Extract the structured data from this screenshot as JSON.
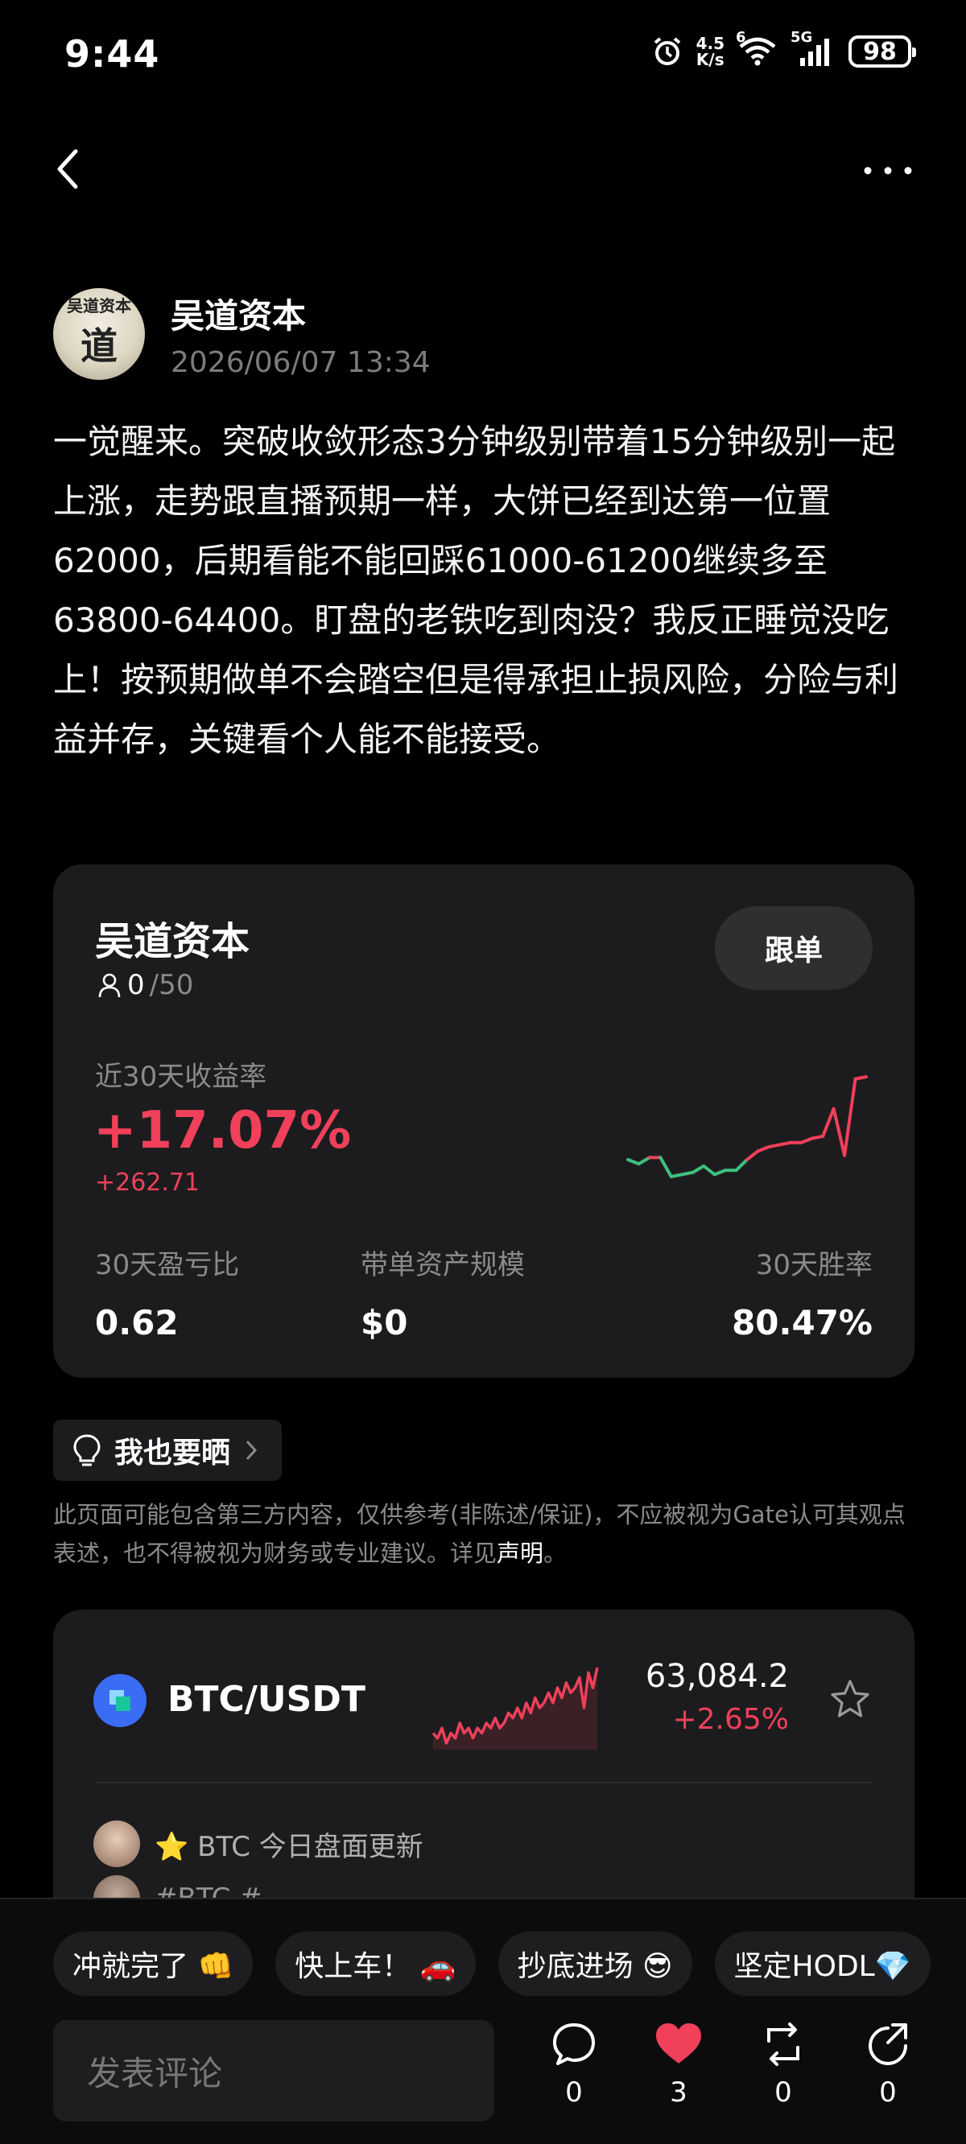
{
  "status_bar": {
    "time": "9:44",
    "net_speed_top": "4.5",
    "net_speed_bottom": "K/s",
    "wifi_badge": "6",
    "signal_badge": "5G",
    "battery": "98"
  },
  "post": {
    "author_name": "吴道资本",
    "avatar_text_top": "吴道资本",
    "avatar_text_main": "道",
    "timestamp": "2026/06/07 13:34",
    "body": "一觉醒来。突破收敛形态3分钟级别带着15分钟级别一起上涨，走势跟直播预期一样，大饼已经到达第一位置62000，后期看能不能回踩61000-61200继续多至63800-64400。盯盘的老铁吃到肉没？我反正睡觉没吃上！按预期做单不会踏空但是得承担止损风险，分险与利益并存，关键看个人能不能接受。"
  },
  "trader_card": {
    "name": "吴道资本",
    "followers_current": "0",
    "followers_max": "/50",
    "follow_button": "跟单",
    "roi_label": "近30天收益率",
    "roi_value": "+17.07%",
    "roi_amount": "+262.71",
    "stats": [
      {
        "label": "30天盈亏比",
        "value": "0.62"
      },
      {
        "label": "带单资产规模",
        "value": "$0"
      },
      {
        "label": "30天胜率",
        "value": "80.47%"
      }
    ],
    "spark": {
      "values": [
        0.0,
        -0.2,
        0.1,
        0.1,
        -0.8,
        -0.7,
        -0.6,
        -0.3,
        -0.7,
        -0.5,
        -0.5,
        0.0,
        0.4,
        0.6,
        0.7,
        0.8,
        0.8,
        1.0,
        1.1,
        2.4,
        0.2,
        3.8,
        3.9
      ],
      "up_color": "#f0405a",
      "down_color": "#3fbf7f"
    }
  },
  "share": {
    "label": "我也要晒"
  },
  "disclaimer": {
    "text": "此页面可能包含第三方内容，仅供参考(非陈述/保证)，不应被视为Gate认可其观点表述，也不得被视为财务或专业建议。详见",
    "link": "声明",
    "end": "。"
  },
  "market": {
    "pair": "BTC/USDT",
    "price": "63,084.2",
    "change": "+2.65%",
    "news_1": "⭐ BTC 今日盘面更新",
    "news_2": "#BTC #",
    "spark_values": [
      3,
      2,
      4,
      1,
      3,
      2,
      5,
      3,
      4,
      2,
      4,
      3,
      5,
      4,
      6,
      4,
      5,
      7,
      6,
      8,
      6,
      9,
      7,
      10,
      8,
      9,
      11,
      9,
      12,
      10,
      13,
      11,
      12,
      14,
      8,
      15,
      12,
      16
    ],
    "spark_color": "#f0405a"
  },
  "bottom": {
    "chips": [
      "冲就完了 👊",
      "快上车！ 🚗",
      "抄底进场 😎",
      "坚定HODL💎"
    ],
    "comment_placeholder": "发表评论",
    "comments": "0",
    "likes": "3",
    "reposts": "0",
    "shares": "0",
    "like_color": "#f0405a"
  }
}
